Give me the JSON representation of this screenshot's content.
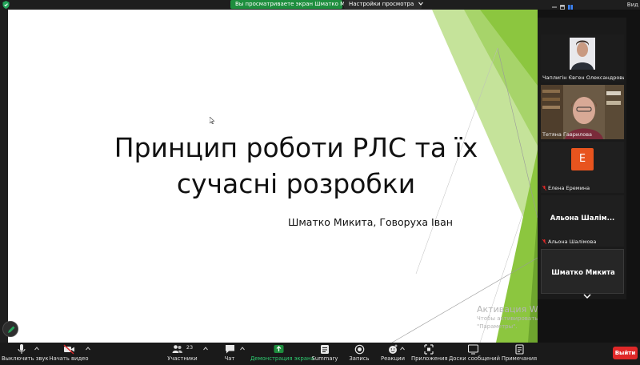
{
  "banner": {
    "viewing_text": "Вы просматриваете экран Шматко Микита",
    "settings_text": "Настройки просмотра",
    "view_label": "Вид"
  },
  "slide": {
    "title_line1": "Принцип роботи РЛС та їх",
    "title_line2": "сучасні розробки",
    "authors": "Шматко Микита, Говоруха Іван",
    "watermark_title": "Активация Windows",
    "watermark_line1": "Чтобы активировать Windows, перейдите в раздел",
    "watermark_line2": "\"Параметры\"."
  },
  "participants": [
    {
      "name": "Чаплигін Євген Олександрович",
      "muted": false,
      "kind": "video"
    },
    {
      "name": "Тетяна Гаврилова",
      "muted": false,
      "kind": "video"
    },
    {
      "name": "Елена Еремина",
      "muted": true,
      "kind": "avatar",
      "initial": "E",
      "avatar_color": "#e8541e"
    },
    {
      "name": "Альона Шалімова",
      "muted": true,
      "kind": "name",
      "display": "Альона Шалім..."
    },
    {
      "name": "Шматко Микита",
      "muted": false,
      "kind": "name",
      "display": "Шматко Микита"
    }
  ],
  "toolbar": {
    "mute": "Выключить звук",
    "video": "Начать видео",
    "participants": "Участники",
    "participants_count": "23",
    "chat": "Чат",
    "share": "Демонстрация экрана",
    "summary": "Summary",
    "record": "Запись",
    "reactions": "Реакции",
    "apps": "Приложения",
    "whiteboards": "Доски сообщений",
    "notes": "Примечания",
    "exit": "Выйти"
  },
  "colors": {
    "share_green": "#1e8e3e",
    "exit_red": "#e02828",
    "slide_green": "#8cc63f"
  }
}
